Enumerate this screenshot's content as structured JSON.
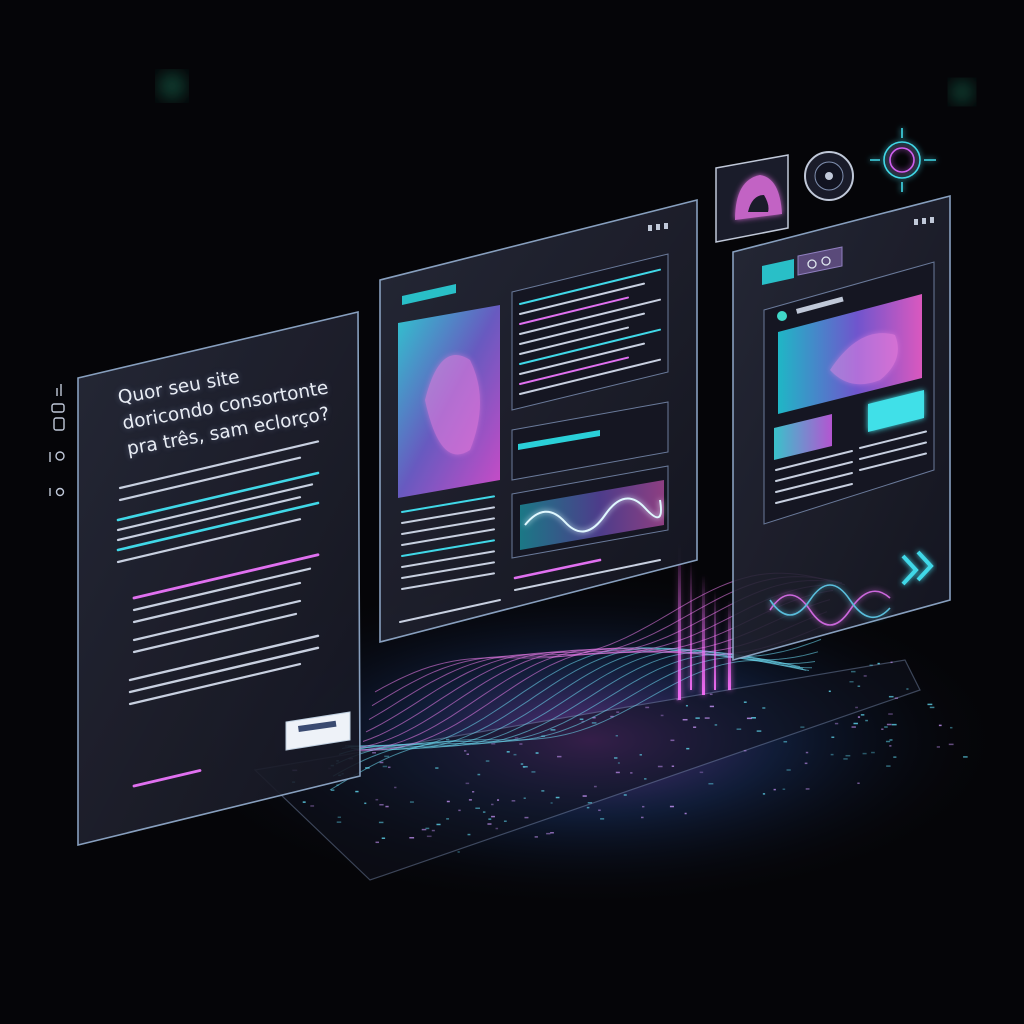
{
  "hero": {
    "headline": "Quor seu site\ndoricondo consortonte\npra três, sam eclorço?",
    "cta_label": ""
  },
  "side_toolbar": {
    "icons": [
      "signal-icon",
      "sliders-icon",
      "mobile-icon",
      "circle-icon",
      "dot-icon"
    ]
  },
  "article_panel": {
    "label_chip": ""
  },
  "product_panel": {
    "header_text": "",
    "next_icon": "double-chevron-right-icon"
  },
  "colors": {
    "background": "#050508",
    "cyan": "#3fe6e6",
    "magenta": "#e060f0",
    "panel_edge": "#8fa8c8",
    "panel_fill": "#1a1c2a"
  }
}
